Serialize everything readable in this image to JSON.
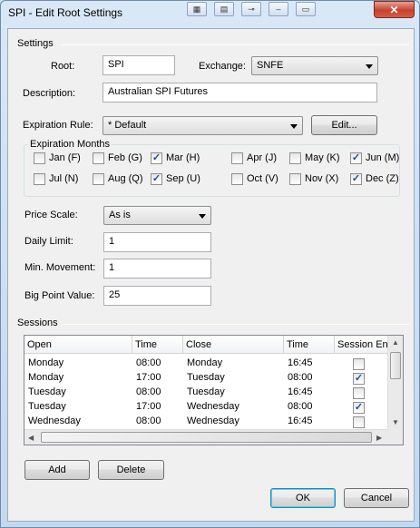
{
  "window": {
    "title": "SPI - Edit Root Settings",
    "close_label": "✕"
  },
  "settings": {
    "group_label": "Settings",
    "root_label": "Root:",
    "root_value": "SPI",
    "exchange_label": "Exchange:",
    "exchange_value": "SNFE",
    "description_label": "Description:",
    "description_value": "Australian SPI Futures",
    "expiration_rule_label": "Expiration Rule:",
    "expiration_rule_value": "* Default",
    "edit_button": "Edit..."
  },
  "expiration_months": {
    "legend": "Expiration Months",
    "months": [
      {
        "label": "Jan (F)",
        "checked": false
      },
      {
        "label": "Feb (G)",
        "checked": false
      },
      {
        "label": "Mar (H)",
        "checked": true
      },
      {
        "label": "Apr (J)",
        "checked": false
      },
      {
        "label": "May (K)",
        "checked": false
      },
      {
        "label": "Jun (M)",
        "checked": true
      },
      {
        "label": "Jul (N)",
        "checked": false
      },
      {
        "label": "Aug (Q)",
        "checked": false
      },
      {
        "label": "Sep (U)",
        "checked": true
      },
      {
        "label": "Oct (V)",
        "checked": false
      },
      {
        "label": "Nov (X)",
        "checked": false
      },
      {
        "label": "Dec (Z)",
        "checked": true
      }
    ]
  },
  "pricing": {
    "price_scale_label": "Price Scale:",
    "price_scale_value": "As is",
    "daily_limit_label": "Daily Limit:",
    "daily_limit_value": "1",
    "min_movement_label": "Min. Movement:",
    "min_movement_value": "1",
    "big_point_value_label": "Big Point Value:",
    "big_point_value_value": "25"
  },
  "sessions": {
    "group_label": "Sessions",
    "columns": [
      "Open",
      "Time",
      "Close",
      "Time",
      "Session End"
    ],
    "rows": [
      {
        "open": "Monday",
        "open_time": "08:00",
        "close": "Monday",
        "close_time": "16:45",
        "session_end": false
      },
      {
        "open": "Monday",
        "open_time": "17:00",
        "close": "Tuesday",
        "close_time": "08:00",
        "session_end": true
      },
      {
        "open": "Tuesday",
        "open_time": "08:00",
        "close": "Tuesday",
        "close_time": "16:45",
        "session_end": false
      },
      {
        "open": "Tuesday",
        "open_time": "17:00",
        "close": "Wednesday",
        "close_time": "08:00",
        "session_end": true
      },
      {
        "open": "Wednesday",
        "open_time": "08:00",
        "close": "Wednesday",
        "close_time": "16:45",
        "session_end": false
      }
    ],
    "add_button": "Add",
    "delete_button": "Delete"
  },
  "footer": {
    "ok_button": "OK",
    "cancel_button": "Cancel"
  }
}
